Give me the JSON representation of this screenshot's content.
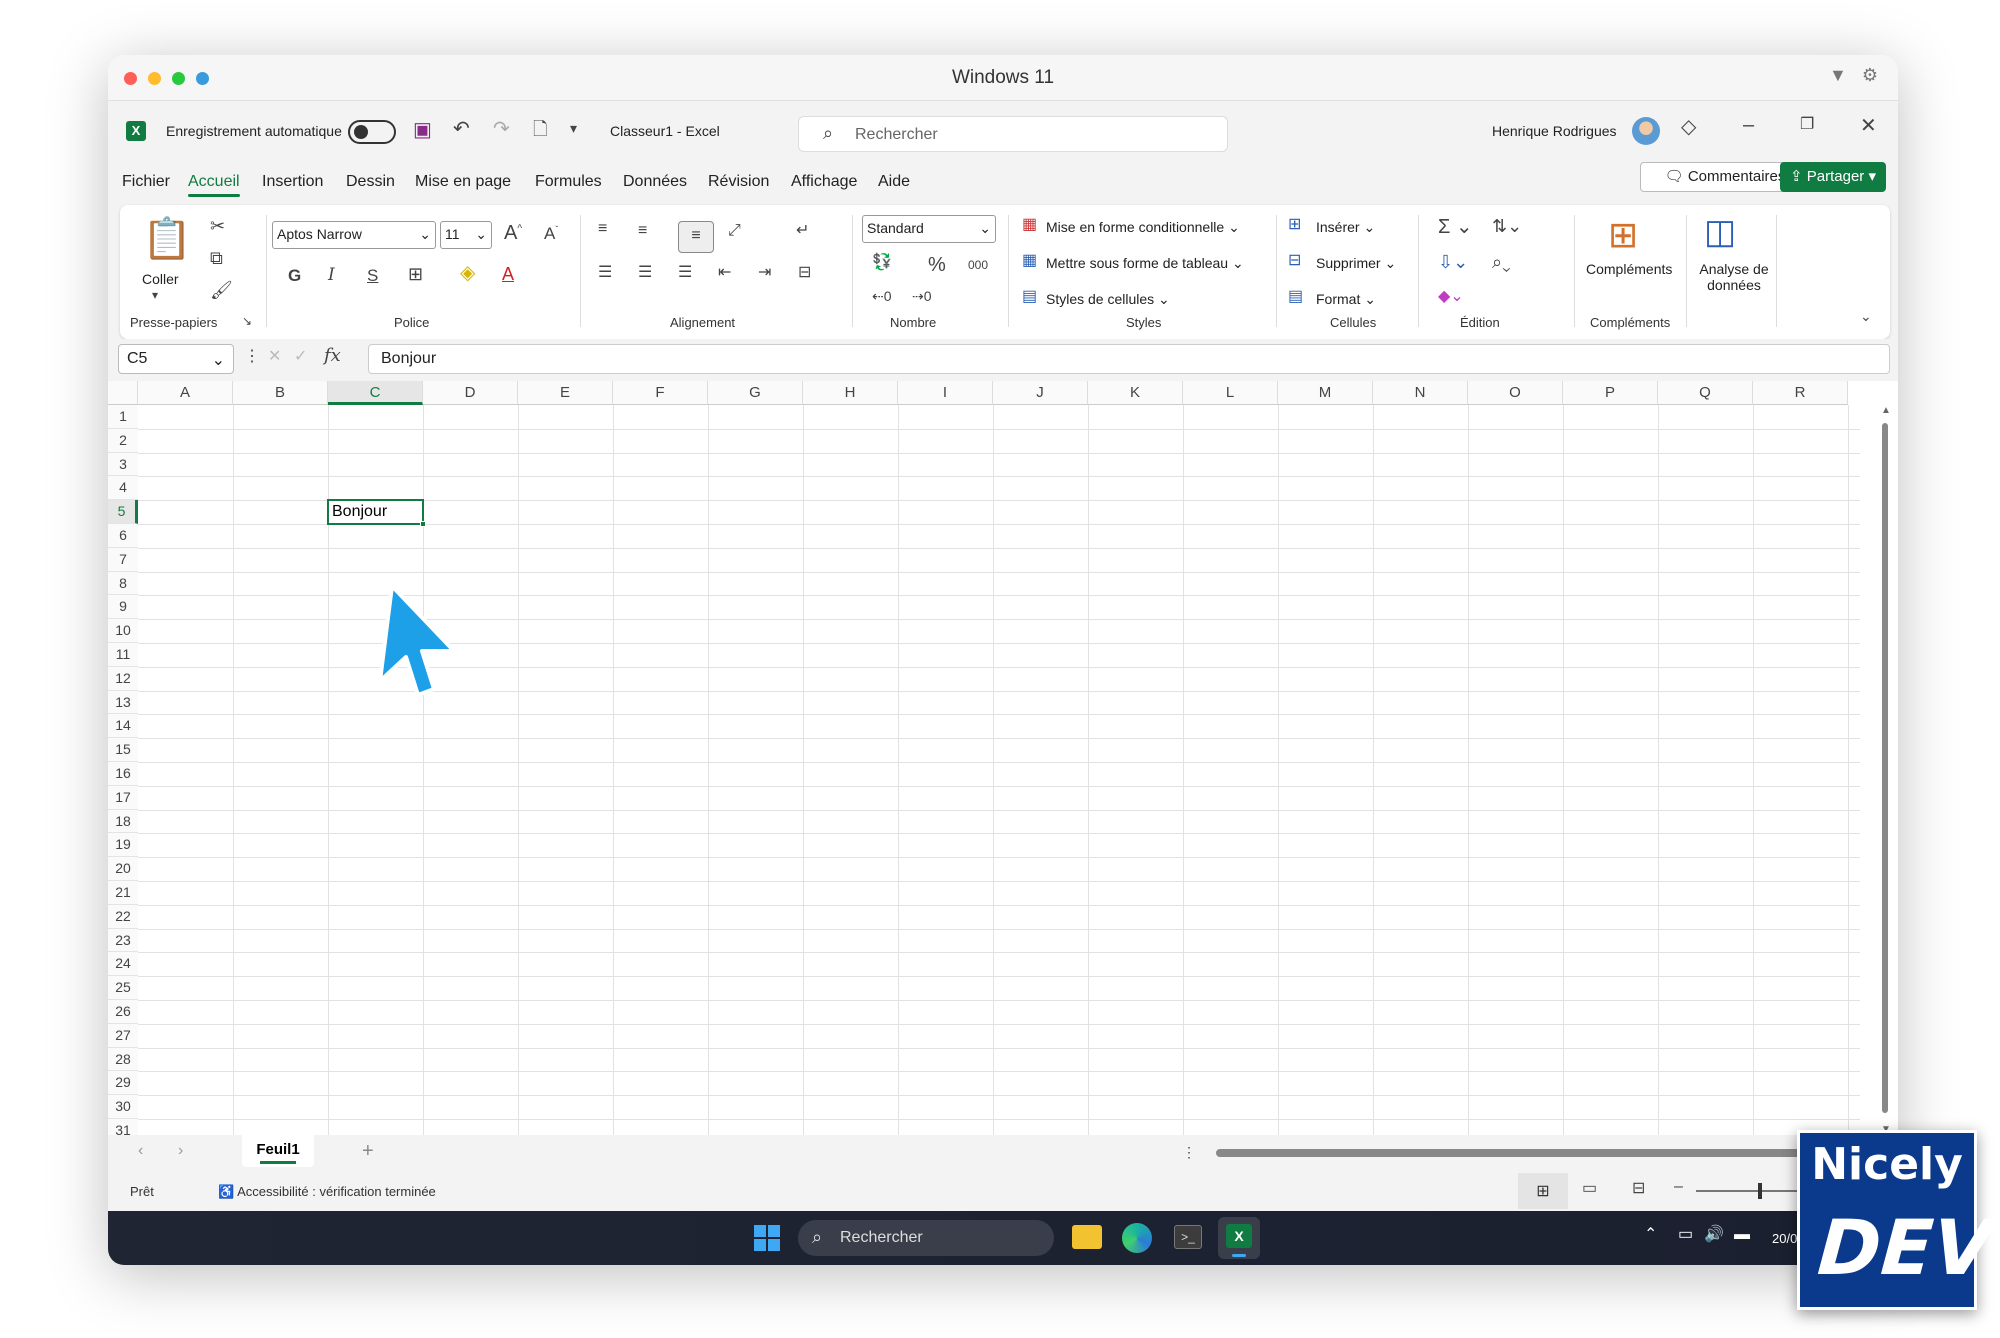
{
  "window": {
    "title": "Windows 11"
  },
  "app": {
    "autosave_label": "Enregistrement automatique",
    "doc_title": "Classeur1",
    "app_name": "Excel",
    "search_placeholder": "Rechercher",
    "user_name": "Henrique Rodrigues"
  },
  "menu": {
    "tabs": [
      "Fichier",
      "Accueil",
      "Insertion",
      "Dessin",
      "Mise en page",
      "Formules",
      "Données",
      "Révision",
      "Affichage",
      "Aide"
    ],
    "active": "Accueil",
    "comments_label": "Commentaires",
    "share_label": "Partager"
  },
  "ribbon": {
    "clipboard": {
      "paste_label": "Coller",
      "group_label": "Presse-papiers"
    },
    "font": {
      "font_name": "Aptos Narrow",
      "font_size": "11",
      "group_label": "Police",
      "bold": "G",
      "italic": "I",
      "underline": "S"
    },
    "alignment": {
      "group_label": "Alignement"
    },
    "number": {
      "format": "Standard",
      "percent": "%",
      "thousands": "000",
      "group_label": "Nombre"
    },
    "styles": {
      "conditional": "Mise en forme conditionnelle",
      "as_table": "Mettre sous forme de tableau",
      "cell_styles": "Styles de cellules",
      "group_label": "Styles"
    },
    "cells": {
      "insert": "Insérer",
      "delete": "Supprimer",
      "format": "Format",
      "group_label": "Cellules"
    },
    "editing": {
      "group_label": "Édition"
    },
    "addins": {
      "addins_label": "Compléments",
      "analyze_line1": "Analyse de",
      "analyze_line2": "données",
      "group_label": "Compléments"
    }
  },
  "formula_bar": {
    "name_box": "C5",
    "fx": "fx",
    "content": "Bonjour"
  },
  "grid": {
    "columns": [
      "A",
      "B",
      "C",
      "D",
      "E",
      "F",
      "G",
      "H",
      "I",
      "J",
      "K",
      "L",
      "M",
      "N",
      "O",
      "P",
      "Q",
      "R"
    ],
    "rows": [
      "1",
      "2",
      "3",
      "4",
      "5",
      "6",
      "7",
      "8",
      "9",
      "10",
      "11",
      "12",
      "13",
      "14",
      "15",
      "16",
      "17",
      "18",
      "19",
      "20",
      "21",
      "22",
      "23",
      "24",
      "25",
      "26",
      "27",
      "28",
      "29",
      "30",
      "31"
    ],
    "selected_cell": "C5",
    "cell_value": "Bonjour"
  },
  "sheets": {
    "tabs": [
      "Feuil1"
    ]
  },
  "status": {
    "ready": "Prêt",
    "accessibility": "Accessibilité : vérification terminée"
  },
  "taskbar": {
    "search_label": "Rechercher",
    "date_partial": "20/0"
  },
  "watermark": {
    "line1": "Nicely",
    "line2": "DEV"
  },
  "colors": {
    "excel_green": "#107c41",
    "cursor_blue": "#1ea0e8",
    "logo_blue": "#0b3a8c"
  }
}
